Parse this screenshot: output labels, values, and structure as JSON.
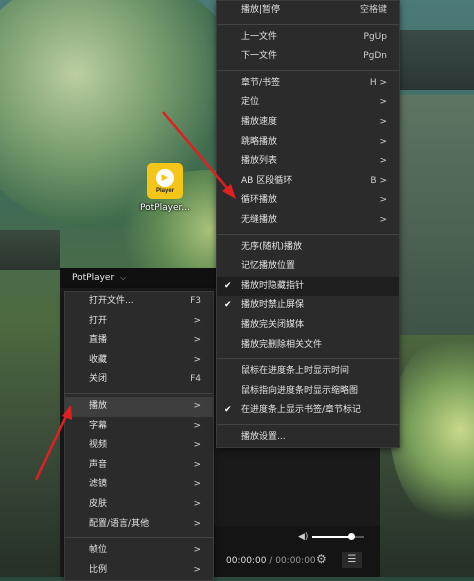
{
  "desktop": {
    "icon_tile_text": "Player",
    "icon_caption": "PotPlayer..."
  },
  "player": {
    "title": "PotPlayer",
    "title_dropdown": "⌵",
    "time_current": "00:00:00",
    "time_separator": "/",
    "time_duration": "00:00:00",
    "volume_level": 0.75
  },
  "left_menu": {
    "items": [
      {
        "label": "打开文件...",
        "key": "F3"
      },
      {
        "label": "打开",
        "key": ">"
      },
      {
        "label": "直播",
        "key": ">"
      },
      {
        "label": "收藏",
        "key": ">"
      },
      {
        "label": "关闭",
        "key": "F4"
      },
      {
        "label": "播放",
        "key": ">"
      },
      {
        "label": "字幕",
        "key": ">"
      },
      {
        "label": "视频",
        "key": ">"
      },
      {
        "label": "声音",
        "key": ">"
      },
      {
        "label": "滤镜",
        "key": ">"
      },
      {
        "label": "皮肤",
        "key": ">"
      },
      {
        "label": "配置/语言/其他",
        "key": ">"
      },
      {
        "label": "帧位",
        "key": ">"
      },
      {
        "label": "比例",
        "key": ">"
      }
    ]
  },
  "right_menu": {
    "items": [
      {
        "label": "播放|暂停",
        "key": "空格键"
      },
      {
        "label": "上一文件",
        "key": "PgUp"
      },
      {
        "label": "下一文件",
        "key": "PgDn"
      },
      {
        "label": "章节/书签",
        "key": "H >"
      },
      {
        "label": "定位",
        "key": ">"
      },
      {
        "label": "播放速度",
        "key": ">"
      },
      {
        "label": "跳略播放",
        "key": ">"
      },
      {
        "label": "播放列表",
        "key": ">"
      },
      {
        "label": "AB 区段循环",
        "key": "B >"
      },
      {
        "label": "循环播放",
        "key": ">"
      },
      {
        "label": "无缝播放",
        "key": ">"
      },
      {
        "label": "无序(随机)播放",
        "key": ""
      },
      {
        "label": "记忆播放位置",
        "key": ""
      },
      {
        "label": "播放时隐藏指针",
        "key": ""
      },
      {
        "label": "播放时禁止屏保",
        "key": ""
      },
      {
        "label": "播放完关闭媒体",
        "key": ""
      },
      {
        "label": "播放完删除相关文件",
        "key": ""
      },
      {
        "label": "鼠标在进度条上时显示时间",
        "key": ""
      },
      {
        "label": "鼠标指向进度条时显示缩略图",
        "key": ""
      },
      {
        "label": "在进度条上显示书签/章节标记",
        "key": ""
      },
      {
        "label": "播放设置...",
        "key": ""
      }
    ],
    "check_mark": "✔"
  },
  "colors": {
    "menu_bg": "#2b2b2b",
    "highlight": "#3e3e3e",
    "arrow": "#e02020",
    "icon_yellow": "#f5c518"
  }
}
